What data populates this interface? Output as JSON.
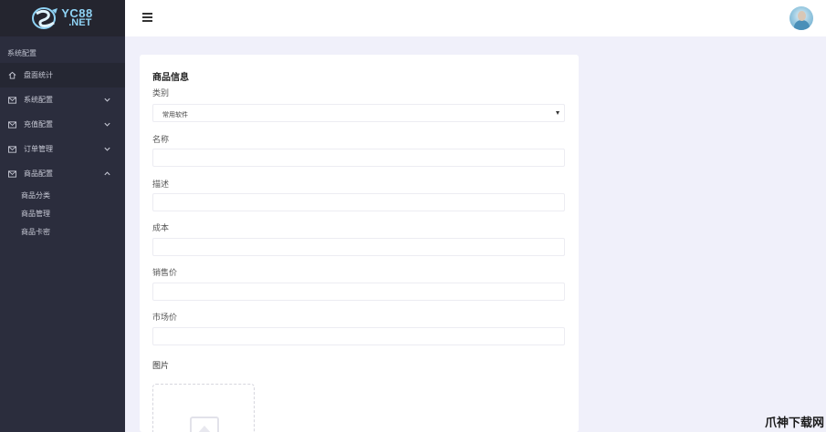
{
  "brand": {
    "line1": "YC88",
    "line2": ".NET"
  },
  "sidebar": {
    "section_title": "系统配置",
    "items": [
      {
        "label": "盘面统计",
        "icon": "home-icon",
        "expandable": false,
        "expanded": false
      },
      {
        "label": "系统配置",
        "icon": "mail-icon",
        "expandable": true,
        "expanded": false
      },
      {
        "label": "充值配置",
        "icon": "mail-icon",
        "expandable": true,
        "expanded": false
      },
      {
        "label": "订单管理",
        "icon": "mail-icon",
        "expandable": true,
        "expanded": false
      },
      {
        "label": "商品配置",
        "icon": "mail-icon",
        "expandable": true,
        "expanded": true
      }
    ],
    "sub_items": [
      {
        "label": "商品分类"
      },
      {
        "label": "商品管理"
      },
      {
        "label": "商品卡密"
      }
    ]
  },
  "header": {
    "menu_icon": "hamburger-icon",
    "avatar_icon": "avatar"
  },
  "form": {
    "title": "商品信息",
    "category": {
      "label": "类别",
      "value": "常用软件"
    },
    "name": {
      "label": "名称",
      "value": ""
    },
    "description": {
      "label": "描述",
      "value": ""
    },
    "cost": {
      "label": "成本",
      "value": ""
    },
    "sale_price": {
      "label": "销售价",
      "value": ""
    },
    "market_price": {
      "label": "市场价",
      "value": ""
    },
    "image": {
      "label": "图片"
    }
  },
  "watermark": "爪神下载网",
  "colors": {
    "sidebar_bg": "#2b2d3d",
    "logo_bg": "#24252f",
    "page_bg": "#f0f0fa",
    "brand": "#8fd3f5"
  }
}
